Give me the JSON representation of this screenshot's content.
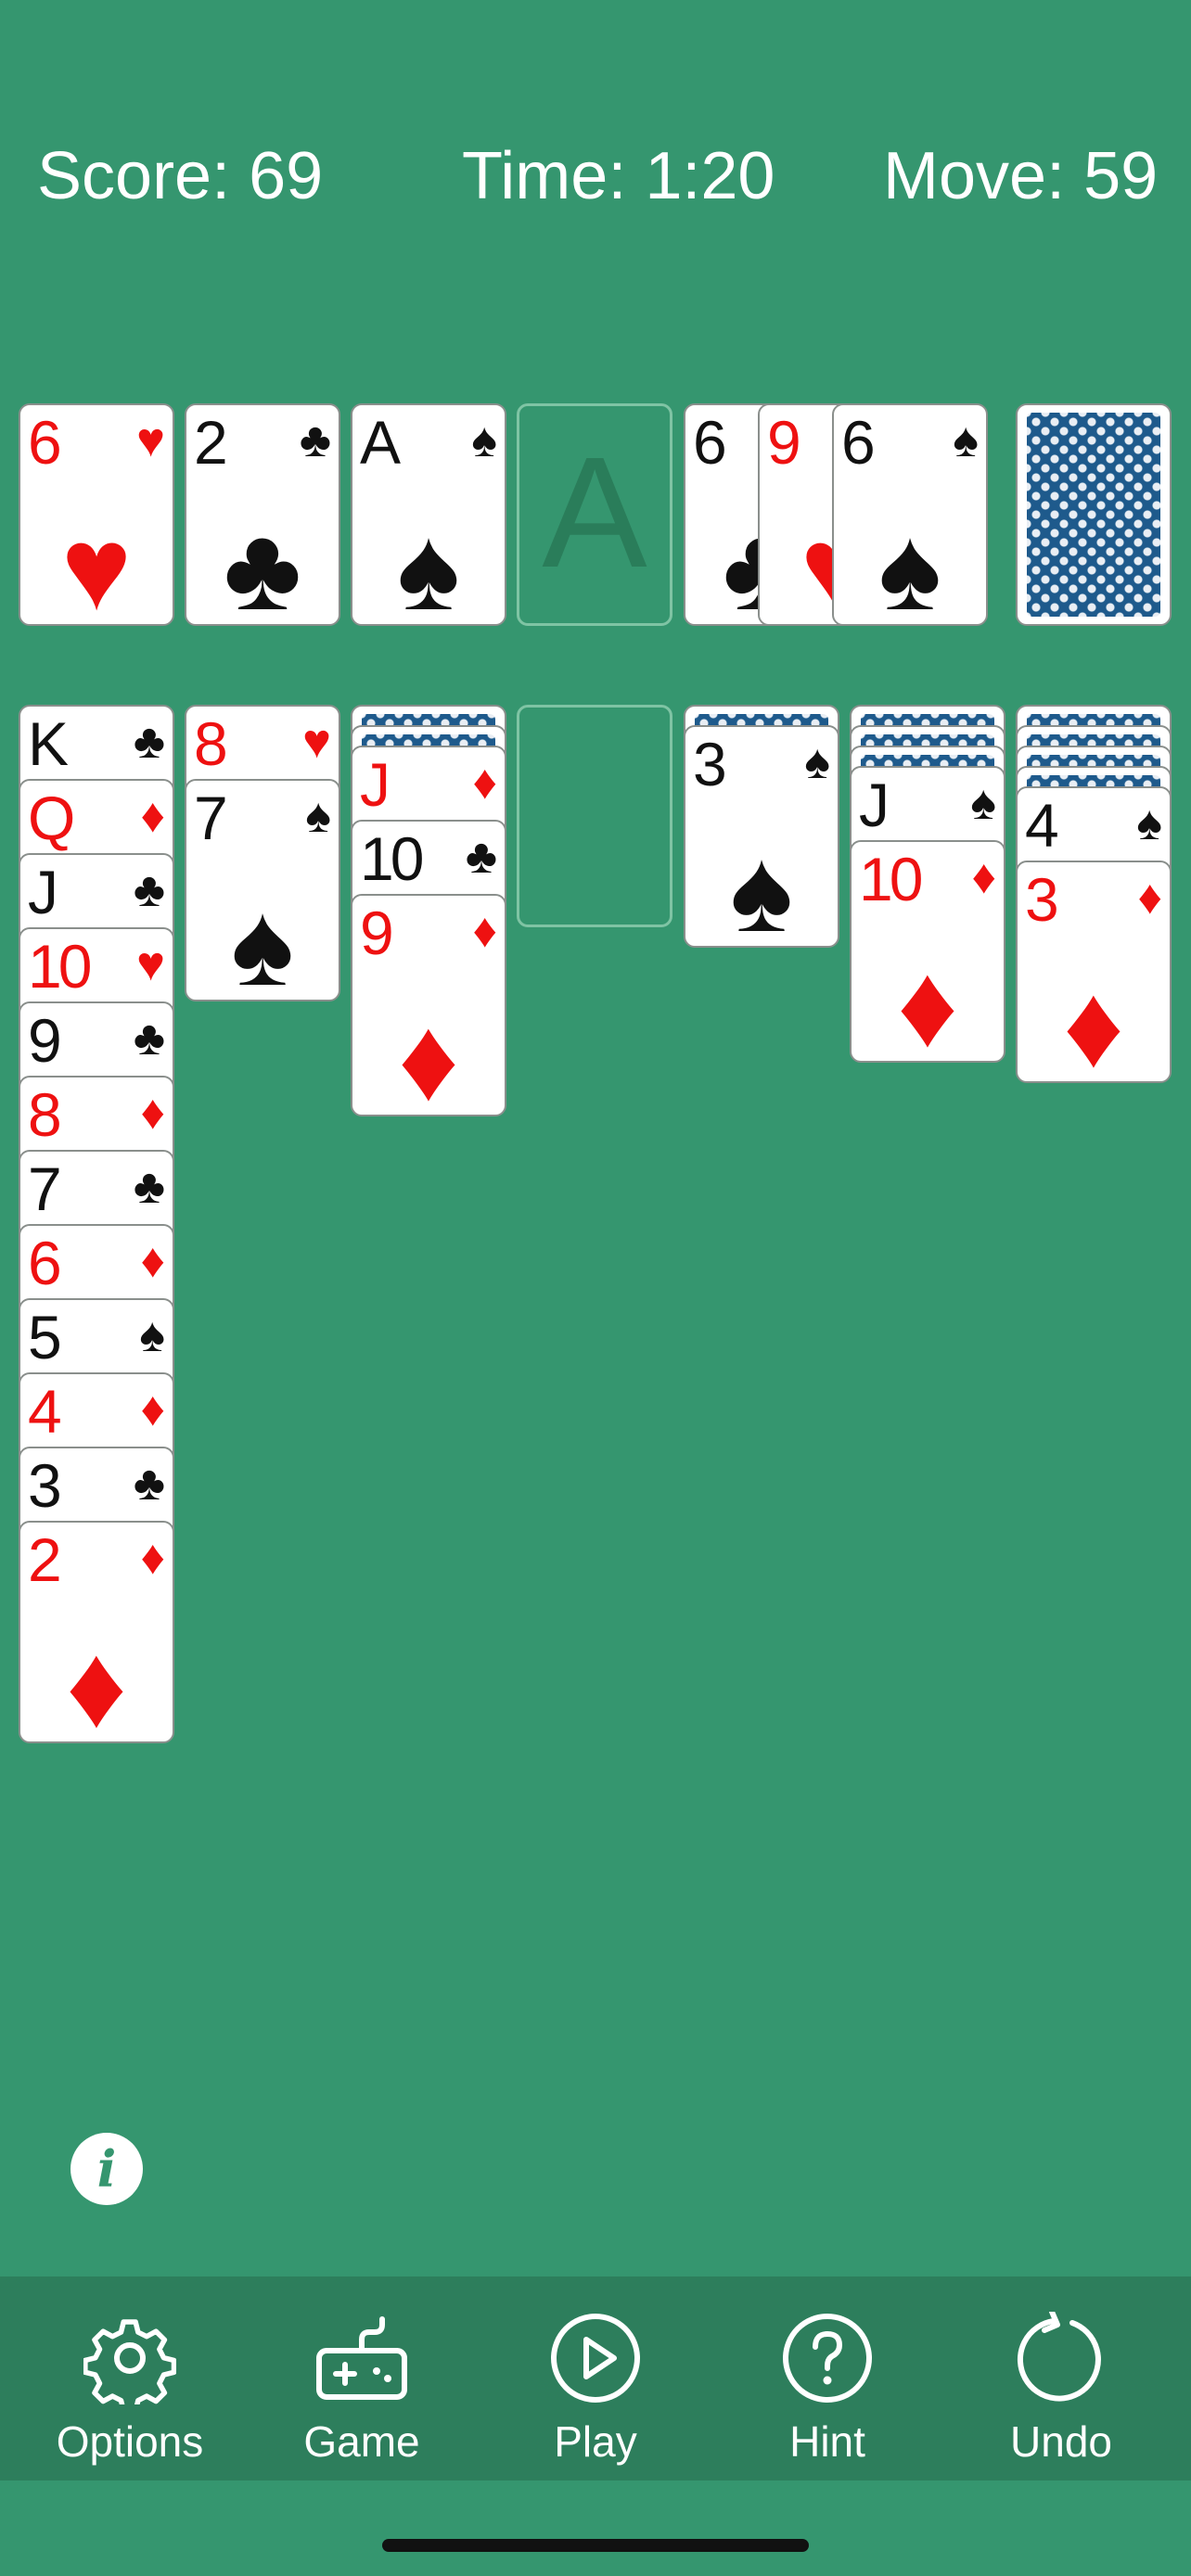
{
  "stats": {
    "score": "Score: 69",
    "time": "Time: 1:20",
    "move": "Move: 59"
  },
  "colors": {
    "felt": "#35966f",
    "toolbar": "#2d7e5c",
    "red_suit": "#ee1111",
    "card_back": "#1e5a8c"
  },
  "foundations": [
    {
      "rank": "6",
      "suit": "♥",
      "color": "red"
    },
    {
      "rank": "2",
      "suit": "♣",
      "color": "black"
    },
    {
      "rank": "A",
      "suit": "♠",
      "color": "black"
    },
    {
      "empty": true,
      "placeholder": "A"
    }
  ],
  "waste": [
    {
      "rank": "6",
      "suit": "♣",
      "color": "black"
    },
    {
      "rank": "9",
      "suit": "♥",
      "color": "red"
    },
    {
      "rank": "6",
      "suit": "♠",
      "color": "black"
    }
  ],
  "stock": {
    "face_down": true
  },
  "tableau": [
    {
      "face_down": 0,
      "cards": [
        {
          "rank": "K",
          "suit": "♣",
          "color": "black"
        },
        {
          "rank": "Q",
          "suit": "♦",
          "color": "red"
        },
        {
          "rank": "J",
          "suit": "♣",
          "color": "black"
        },
        {
          "rank": "10",
          "suit": "♥",
          "color": "red"
        },
        {
          "rank": "9",
          "suit": "♣",
          "color": "black"
        },
        {
          "rank": "8",
          "suit": "♦",
          "color": "red"
        },
        {
          "rank": "7",
          "suit": "♣",
          "color": "black"
        },
        {
          "rank": "6",
          "suit": "♦",
          "color": "red"
        },
        {
          "rank": "5",
          "suit": "♠",
          "color": "black"
        },
        {
          "rank": "4",
          "suit": "♦",
          "color": "red"
        },
        {
          "rank": "3",
          "suit": "♣",
          "color": "black"
        },
        {
          "rank": "2",
          "suit": "♦",
          "color": "red"
        }
      ]
    },
    {
      "face_down": 0,
      "cards": [
        {
          "rank": "8",
          "suit": "♥",
          "color": "red"
        },
        {
          "rank": "7",
          "suit": "♠",
          "color": "black"
        }
      ]
    },
    {
      "face_down": 2,
      "cards": [
        {
          "rank": "J",
          "suit": "♦",
          "color": "red"
        },
        {
          "rank": "10",
          "suit": "♣",
          "color": "black"
        },
        {
          "rank": "9",
          "suit": "♦",
          "color": "red"
        }
      ]
    },
    {
      "face_down": 0,
      "cards": [],
      "empty": true
    },
    {
      "face_down": 1,
      "cards": [
        {
          "rank": "3",
          "suit": "♠",
          "color": "black"
        }
      ]
    },
    {
      "face_down": 3,
      "cards": [
        {
          "rank": "J",
          "suit": "♠",
          "color": "black"
        },
        {
          "rank": "10",
          "suit": "♦",
          "color": "red"
        }
      ]
    },
    {
      "face_down": 4,
      "cards": [
        {
          "rank": "4",
          "suit": "♠",
          "color": "black"
        },
        {
          "rank": "3",
          "suit": "♦",
          "color": "red"
        }
      ]
    }
  ],
  "info_icon": {
    "glyph": "i",
    "icon": "info-icon"
  },
  "toolbar": [
    {
      "label": "Options",
      "icon": "gear-icon"
    },
    {
      "label": "Game",
      "icon": "gamepad-icon"
    },
    {
      "label": "Play",
      "icon": "play-icon"
    },
    {
      "label": "Hint",
      "icon": "hint-icon"
    },
    {
      "label": "Undo",
      "icon": "undo-icon"
    }
  ]
}
